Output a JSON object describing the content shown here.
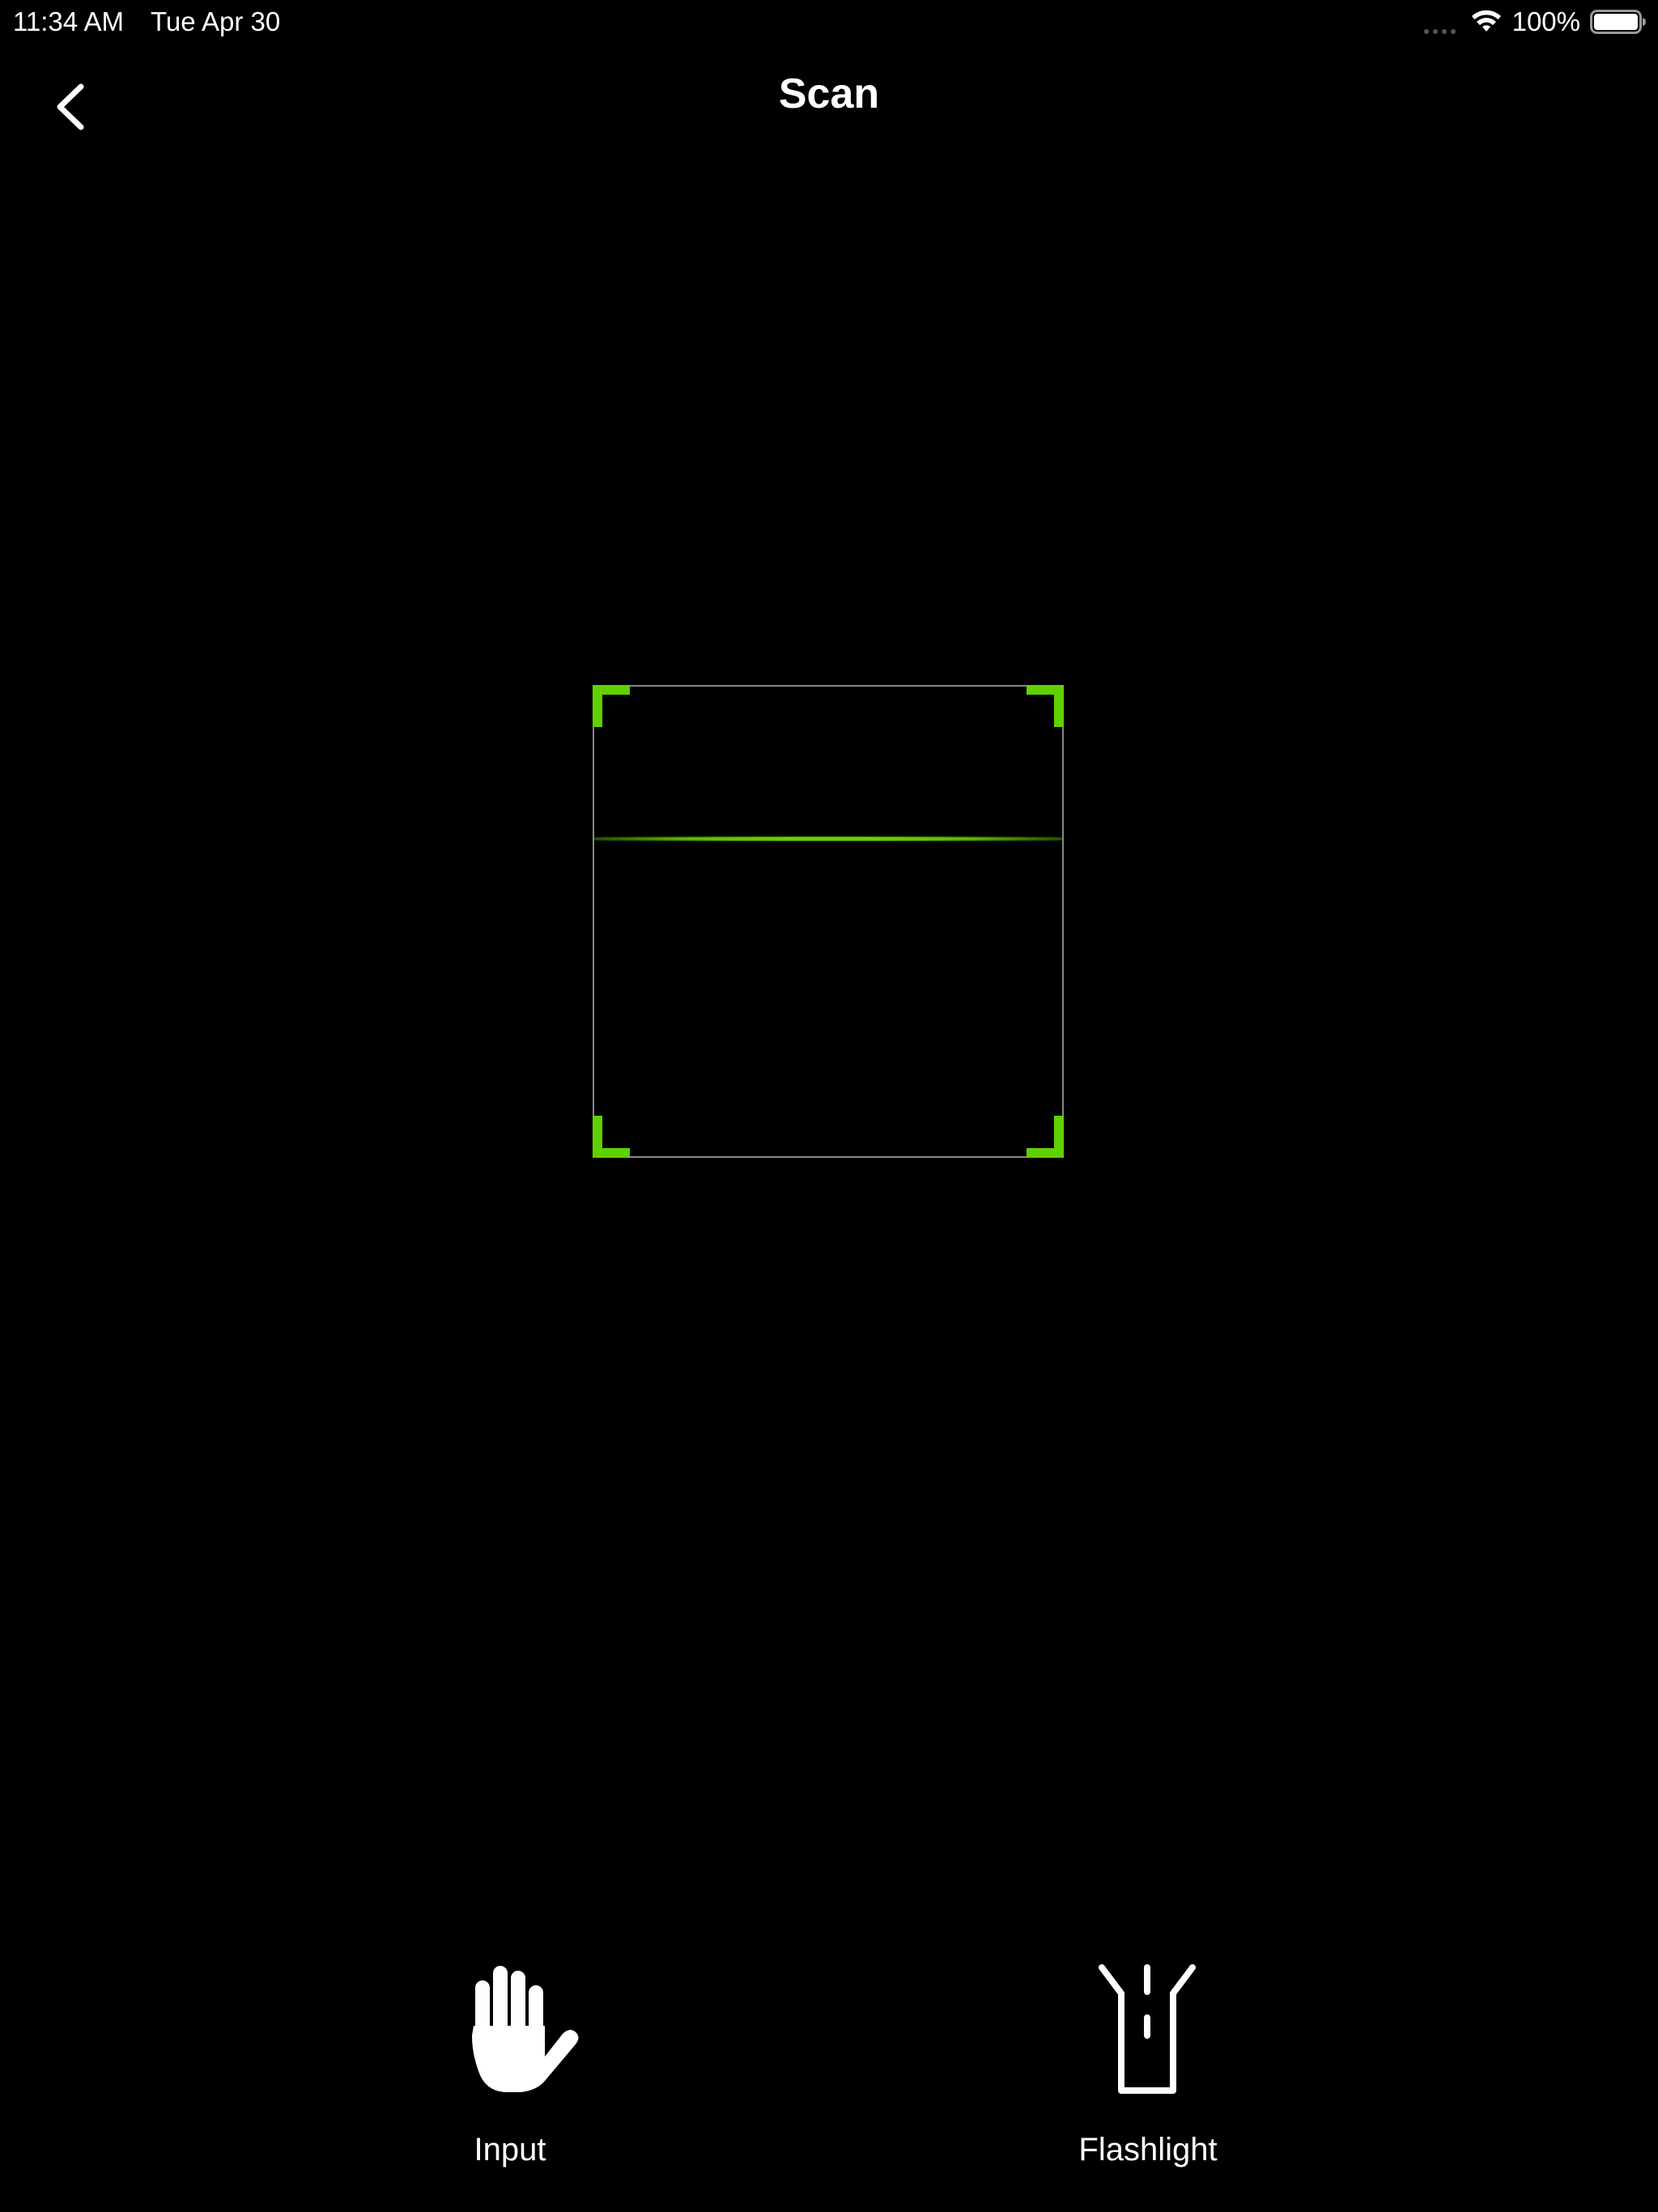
{
  "status_bar": {
    "time": "11:34 AM",
    "date": "Tue Apr 30",
    "battery_percent": "100%",
    "battery_level": 1.0,
    "icons": [
      "cellular-signal-icon",
      "wifi-icon",
      "battery-icon"
    ]
  },
  "nav": {
    "title": "Scan",
    "back_icon": "chevron-left-icon"
  },
  "scanner": {
    "accent_color": "#5fd100",
    "frame_border_color": "#888888"
  },
  "actions": {
    "input": {
      "label": "Input",
      "icon": "hand-icon"
    },
    "flashlight": {
      "label": "Flashlight",
      "icon": "flashlight-icon"
    }
  }
}
